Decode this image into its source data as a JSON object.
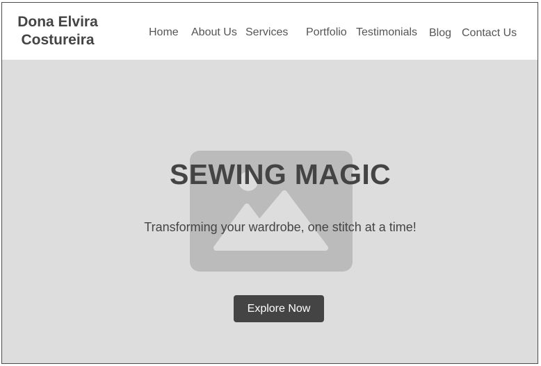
{
  "brand": {
    "line1": "Dona Elvira",
    "line2": "Costureira"
  },
  "nav": {
    "items": [
      {
        "label": "Home"
      },
      {
        "label": "About Us"
      },
      {
        "label": "Services"
      },
      {
        "label": "Portfolio"
      },
      {
        "label": "Testimonials"
      },
      {
        "label": "Blog"
      },
      {
        "label": "Contact Us"
      }
    ]
  },
  "hero": {
    "title": "SEWING MAGIC",
    "subtitle": "Transforming your wardrobe, one stitch at a time!",
    "cta_label": "Explore Now",
    "background_icon": "image-placeholder-icon"
  },
  "colors": {
    "header_bg": "#ffffff",
    "hero_bg": "#dddddd",
    "placeholder": "#bbbbbb",
    "text_dark": "#444444",
    "button_bg": "#444444",
    "button_text": "#ffffff"
  }
}
